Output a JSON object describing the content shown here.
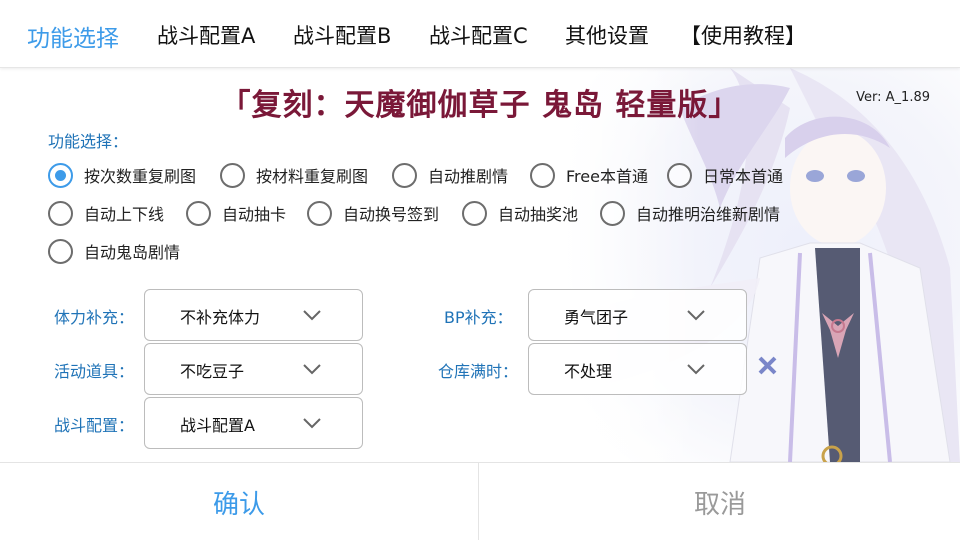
{
  "tabs": [
    {
      "label": "功能选择",
      "active": true
    },
    {
      "label": "战斗配置A",
      "active": false
    },
    {
      "label": "战斗配置B",
      "active": false
    },
    {
      "label": "战斗配置C",
      "active": false
    },
    {
      "label": "其他设置",
      "active": false
    },
    {
      "label": "【使用教程】",
      "active": false
    }
  ],
  "header": {
    "title": "「复刻：天魔御伽草子 鬼岛 轻量版」",
    "version": "Ver: A_1.89"
  },
  "function_select": {
    "label": "功能选择：",
    "options": [
      {
        "label": "按次数重复刷图",
        "checked": true
      },
      {
        "label": "按材料重复刷图",
        "checked": false
      },
      {
        "label": "自动推剧情",
        "checked": false
      },
      {
        "label": "Free本首通",
        "checked": false
      },
      {
        "label": "日常本首通",
        "checked": false
      },
      {
        "label": "自动上下线",
        "checked": false
      },
      {
        "label": "自动抽卡",
        "checked": false
      },
      {
        "label": "自动换号签到",
        "checked": false
      },
      {
        "label": "自动抽奖池",
        "checked": false
      },
      {
        "label": "自动推明治维新剧情",
        "checked": false
      },
      {
        "label": "自动鬼岛剧情",
        "checked": false
      }
    ]
  },
  "settings": {
    "stamina": {
      "label": "体力补充：",
      "value": "不补充体力"
    },
    "bp": {
      "label": "BP补充：",
      "value": "勇气团子"
    },
    "event_item": {
      "label": "活动道具：",
      "value": "不吃豆子"
    },
    "warehouse": {
      "label": "仓库满时：",
      "value": "不处理"
    },
    "battle_config": {
      "label": "战斗配置：",
      "value": "战斗配置A"
    }
  },
  "buttons": {
    "confirm": "确认",
    "cancel": "取消"
  },
  "colors": {
    "accent": "#3d9be9",
    "label_blue": "#1f73b7",
    "title": "#7a1838"
  }
}
